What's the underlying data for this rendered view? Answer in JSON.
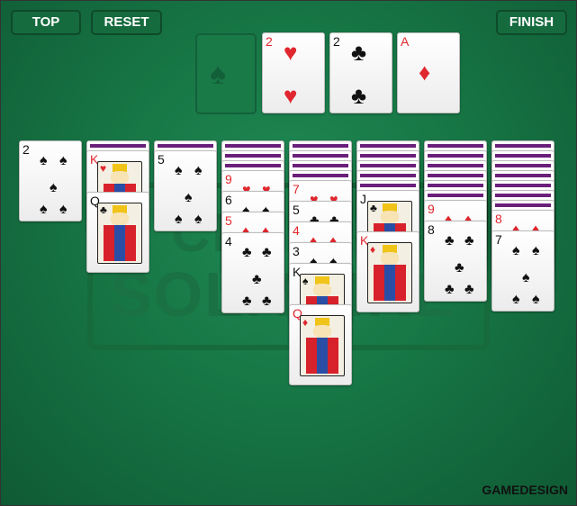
{
  "toolbar": {
    "top_label": "TOP",
    "reset_label": "RESET",
    "finish_label": "FINISH"
  },
  "watermark": {
    "line1": "CL",
    "line2": "SOLITAIRE"
  },
  "brand": "GAMEDESIGN",
  "colors": {
    "felt": "#177645",
    "card_back_stripe": "#6a1f7a",
    "red_suit": "#e0262e"
  },
  "foundation": [
    {
      "rank": "2",
      "suit": "♥",
      "color": "red"
    },
    {
      "rank": "2",
      "suit": "♣",
      "color": "black"
    },
    {
      "rank": "A",
      "suit": "♦",
      "color": "red"
    }
  ],
  "empty_slot_icon": "spade-icon",
  "tableau": [
    {
      "hidden": 0,
      "cards": [
        {
          "rank": "2",
          "suit": "♠",
          "color": "black"
        }
      ]
    },
    {
      "hidden": 1,
      "cards": [
        {
          "rank": "K",
          "suit": "♥",
          "color": "red",
          "face": true
        },
        {
          "rank": "Q",
          "suit": "♣",
          "color": "black",
          "face": true
        }
      ]
    },
    {
      "hidden": 1,
      "cards": [
        {
          "rank": "5",
          "suit": "♠",
          "color": "black"
        }
      ]
    },
    {
      "hidden": 3,
      "cards": [
        {
          "rank": "9",
          "suit": "♥",
          "color": "red"
        },
        {
          "rank": "6",
          "suit": "♠",
          "color": "black"
        },
        {
          "rank": "5",
          "suit": "♦",
          "color": "red"
        },
        {
          "rank": "4",
          "suit": "♣",
          "color": "black"
        }
      ]
    },
    {
      "hidden": 4,
      "cards": [
        {
          "rank": "7",
          "suit": "♥",
          "color": "red"
        },
        {
          "rank": "5",
          "suit": "♣",
          "color": "black"
        },
        {
          "rank": "4",
          "suit": "♦",
          "color": "red"
        },
        {
          "rank": "3",
          "suit": "♠",
          "color": "black"
        },
        {
          "rank": "K",
          "suit": "♠",
          "color": "black",
          "face": true
        },
        {
          "rank": "Q",
          "suit": "♦",
          "color": "red",
          "face": true
        }
      ]
    },
    {
      "hidden": 5,
      "cards": [
        {
          "rank": "J",
          "suit": "♣",
          "color": "black",
          "face": true
        },
        {
          "rank": "K",
          "suit": "♦",
          "color": "red",
          "face": true
        }
      ]
    },
    {
      "hidden": 6,
      "cards": [
        {
          "rank": "9",
          "suit": "♦",
          "color": "red"
        },
        {
          "rank": "8",
          "suit": "♣",
          "color": "black"
        }
      ]
    },
    {
      "hidden": 7,
      "cards": [
        {
          "rank": "8",
          "suit": "♦",
          "color": "red"
        },
        {
          "rank": "7",
          "suit": "♠",
          "color": "black"
        }
      ]
    }
  ]
}
